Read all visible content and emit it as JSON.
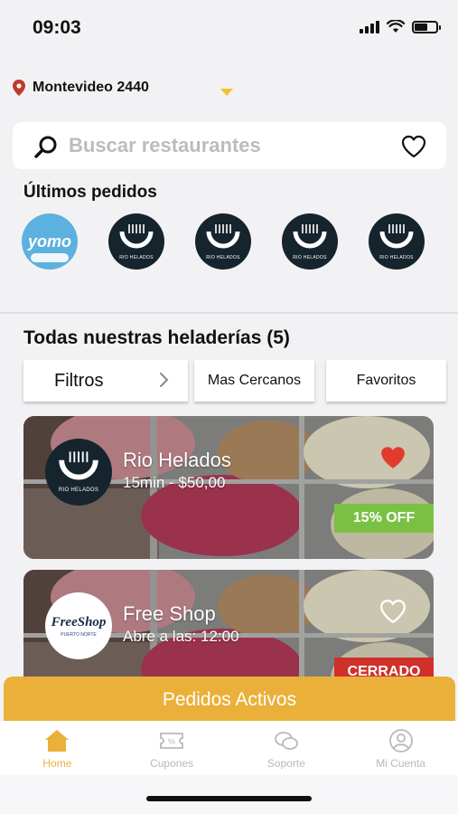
{
  "status_bar": {
    "time": "09:03"
  },
  "location": {
    "address": "Montevideo 2440"
  },
  "search": {
    "placeholder": "Buscar restaurantes"
  },
  "recent": {
    "title": "Últimos pedidos",
    "items": [
      {
        "name": "yomo"
      },
      {
        "name": "RIO HELADOS"
      },
      {
        "name": "RIO HELADOS"
      },
      {
        "name": "RIO HELADOS"
      },
      {
        "name": "RIO HELADOS"
      }
    ]
  },
  "all_shops": {
    "title": "Todas nuestras heladerías (5)",
    "filters": {
      "main": "Filtros",
      "nearest": "Mas Cercanos",
      "favorites": "Favoritos"
    },
    "cards": [
      {
        "name": "Rio Helados",
        "meta": "15min - $50,00",
        "logo_text": "RIO HELADOS",
        "favorite": true,
        "badge": "15% OFF"
      },
      {
        "name": "Free Shop",
        "meta": "Abre a las: 12:00",
        "logo_text": "FreeShop",
        "logo_sub": "PUERTO NORTE",
        "favorite": false,
        "badge": "CERRADO"
      }
    ]
  },
  "active_orders": {
    "label": "Pedidos Activos"
  },
  "tabbar": {
    "tabs": [
      {
        "label": "Home",
        "icon": "home-icon"
      },
      {
        "label": "Cupones",
        "icon": "coupon-icon"
      },
      {
        "label": "Soporte",
        "icon": "chat-icon"
      },
      {
        "label": "Mi Cuenta",
        "icon": "user-icon"
      }
    ]
  },
  "colors": {
    "accent": "#eab03a",
    "discount": "#7ac143",
    "closed": "#d0302a",
    "favorite": "#e23b2e"
  }
}
